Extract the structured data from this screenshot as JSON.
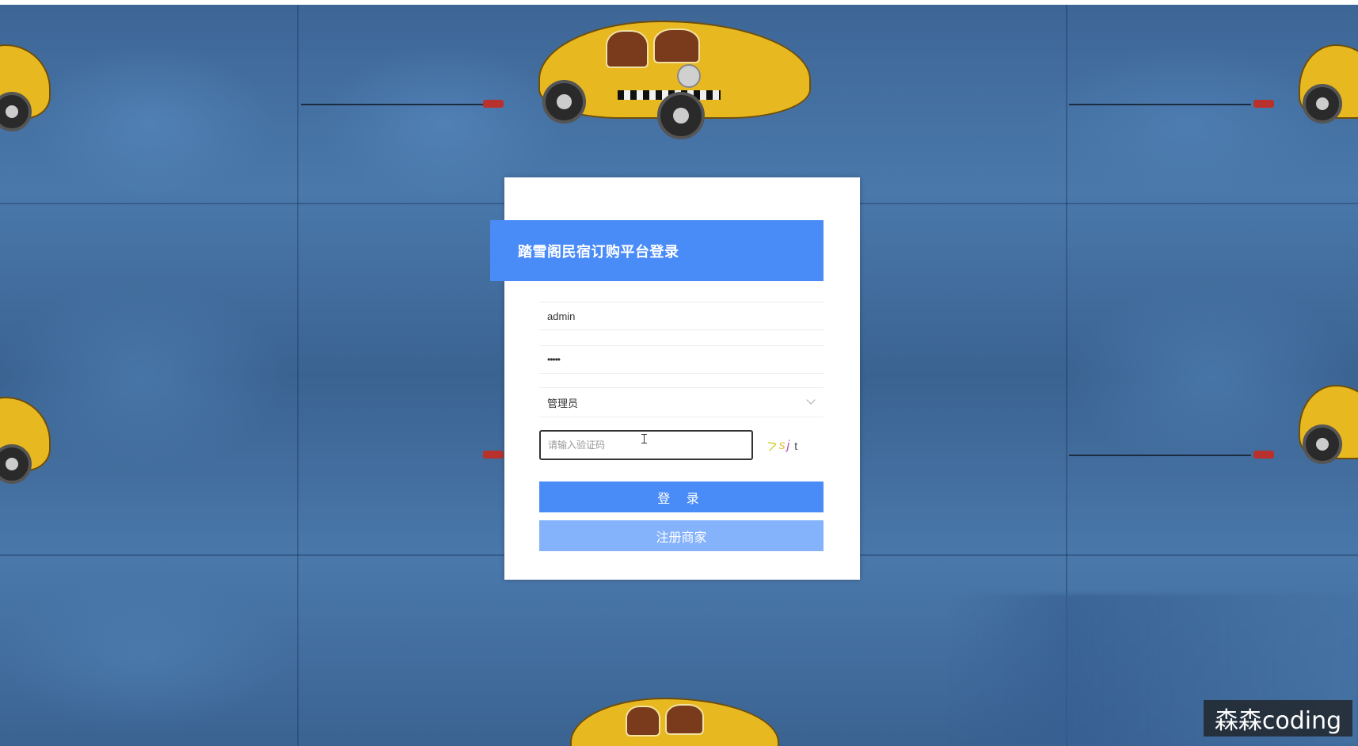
{
  "login": {
    "title": "踏雪阁民宿订购平台登录",
    "username_value": "admin",
    "password_value": "•••••",
    "role_selected": "管理员",
    "captcha_placeholder": "请输入验证码",
    "captcha_chars": [
      "ᐳ",
      "s",
      "j",
      "t"
    ],
    "login_label": "登 录",
    "register_label": "注册商家"
  },
  "watermark": "森森coding",
  "colors": {
    "primary": "#4a8cf7",
    "primary_light": "#84b2fb",
    "background": "#3d6696"
  }
}
